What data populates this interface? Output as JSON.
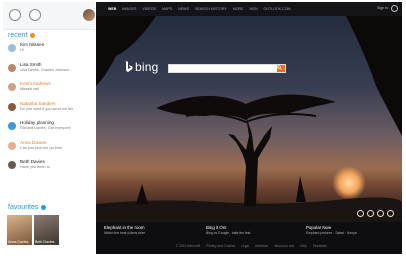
{
  "sidebar": {
    "recent_title": "recent",
    "recent": [
      {
        "name": "Kim Nilssen",
        "message": "Hi",
        "status": "normal"
      },
      {
        "name": "Lisa Smith",
        "message": "Lisa Deeks, Charles Johnson...",
        "status": "normal"
      },
      {
        "name": "Kenni Andrews",
        "message": "Missed call",
        "status": "highlight"
      },
      {
        "name": "Natasha Sanders",
        "message": "Do you mind if you send me the",
        "status": "highlight"
      },
      {
        "name": "Holiday planning",
        "message": "Richard Davies: Got everyone",
        "status": "normal"
      },
      {
        "name": "Anna Davies",
        "message": "Can you pick me up from",
        "status": "highlight"
      },
      {
        "name": "Beth Davies",
        "message": "Have you been to",
        "status": "normal"
      }
    ],
    "favourites_title": "favourites",
    "favourites": [
      {
        "name": "Anna Davies"
      },
      {
        "name": "Beth Davies"
      }
    ]
  },
  "browser": {
    "nav": [
      "WEB",
      "IMAGES",
      "VIDEOS",
      "MAPS",
      "NEWS",
      "SEARCH HISTORY",
      "MORE",
      "MSN",
      "OUTLOOK.COM"
    ],
    "active_nav": "WEB",
    "account_label": "Sign in",
    "brand": "bing",
    "search_placeholder": "",
    "panels": [
      {
        "title": "Elephant in the room",
        "subtitle": "Watch the best videos here"
      },
      {
        "title": "Bing it On!",
        "subtitle": "Bing vs Google - take the test"
      },
      {
        "title": "Popular Now",
        "subtitle": "Elephant pictures · Safari · Kenya"
      }
    ],
    "footer": [
      "© 2013 Microsoft",
      "Privacy and Cookies",
      "Legal",
      "Advertise",
      "About our ads",
      "Help",
      "Feedback"
    ]
  }
}
